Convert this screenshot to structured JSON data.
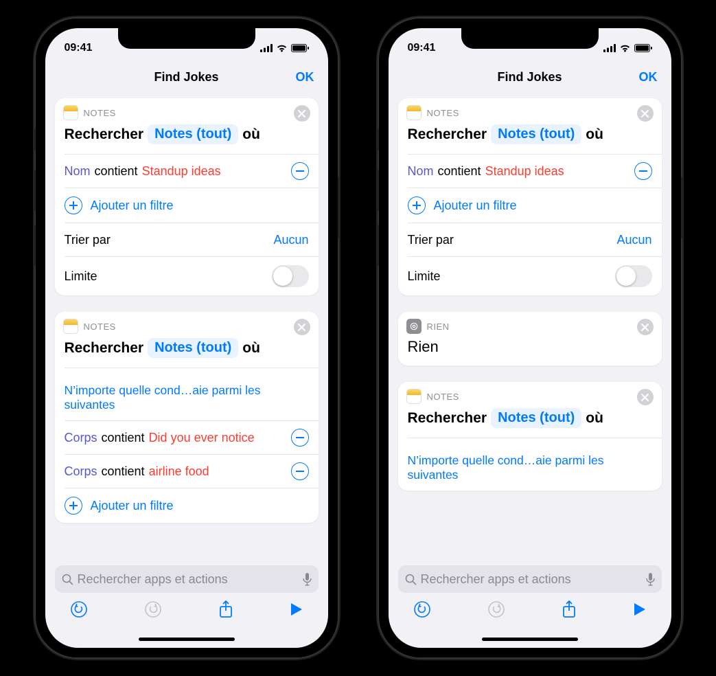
{
  "status": {
    "time": "09:41"
  },
  "nav": {
    "title": "Find Jokes",
    "done": "OK"
  },
  "search_placeholder": "Rechercher apps et actions",
  "left_phone": {
    "card1": {
      "app": "NOTES",
      "verb": "Rechercher",
      "token": "Notes (tout)",
      "suffix": "où",
      "filters": [
        {
          "attr": "Nom",
          "op": "contient",
          "val": "Standup ideas"
        }
      ],
      "add_filter": "Ajouter un filtre",
      "sort_label": "Trier par",
      "sort_value": "Aucun",
      "limit_label": "Limite"
    },
    "card2": {
      "app": "NOTES",
      "verb": "Rechercher",
      "token": "Notes (tout)",
      "suffix": "où",
      "condition": "N’importe quelle cond…aie parmi les suivantes",
      "filters": [
        {
          "attr": "Corps",
          "op": "contient",
          "val": "Did you ever notice"
        },
        {
          "attr": "Corps",
          "op": "contient",
          "val": "airline food"
        }
      ],
      "add_filter": "Ajouter un filtre"
    }
  },
  "right_phone": {
    "card1": {
      "app": "NOTES",
      "verb": "Rechercher",
      "token": "Notes (tout)",
      "suffix": "où",
      "filters": [
        {
          "attr": "Nom",
          "op": "contient",
          "val": "Standup ideas"
        }
      ],
      "add_filter": "Ajouter un filtre",
      "sort_label": "Trier par",
      "sort_value": "Aucun",
      "limit_label": "Limite"
    },
    "card_rien": {
      "app": "RIEN",
      "title": "Rien"
    },
    "card3": {
      "app": "NOTES",
      "verb": "Rechercher",
      "token": "Notes (tout)",
      "suffix": "où",
      "condition": "N’importe quelle cond…aie parmi les suivantes"
    }
  }
}
